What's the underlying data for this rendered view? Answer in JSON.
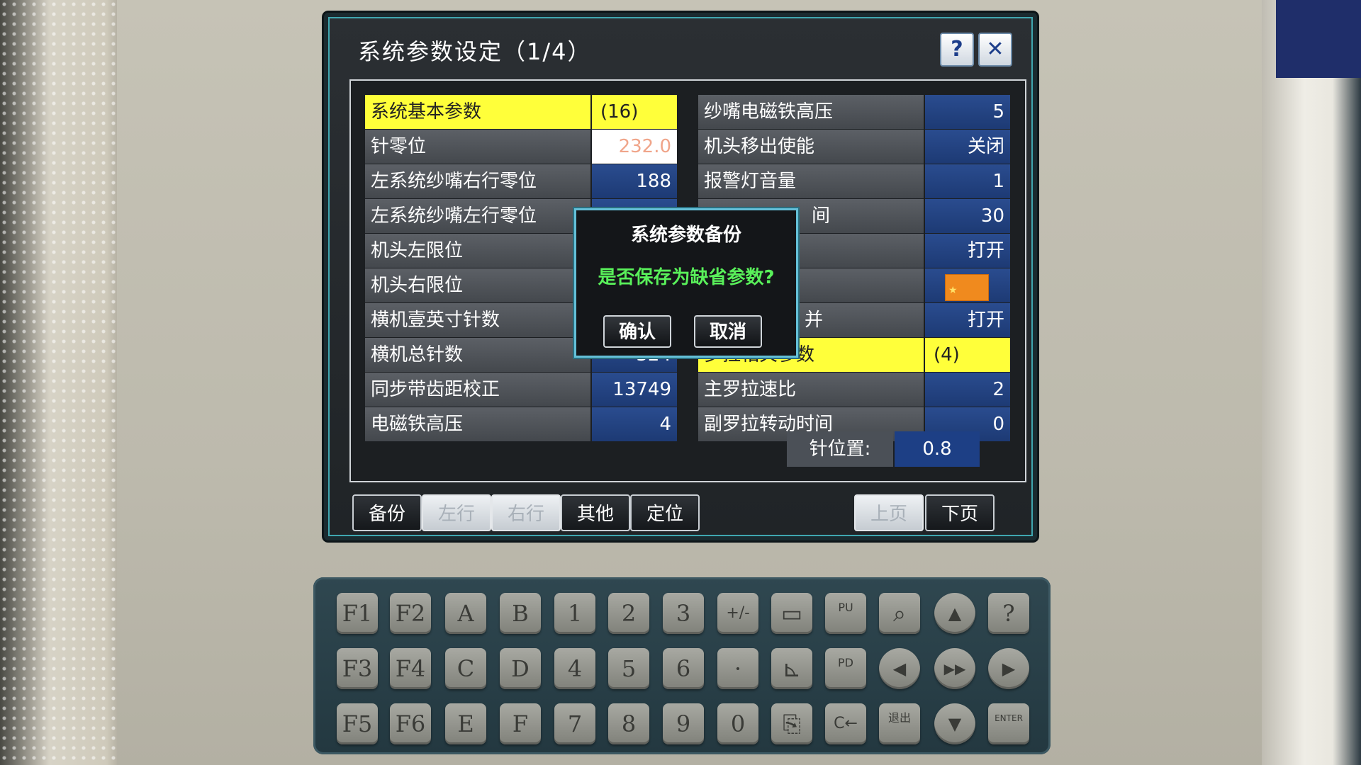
{
  "window": {
    "title": "系统参数设定（1/4）",
    "help_label": "?",
    "close_label": "✕"
  },
  "left_table": {
    "rows": [
      {
        "label": "系统基本参数",
        "value": "(16)"
      },
      {
        "label": "针零位",
        "value": "232.0"
      },
      {
        "label": "左系统纱嘴右行零位",
        "value": "188"
      },
      {
        "label": "左系统纱嘴左行零位",
        "value": ""
      },
      {
        "label": "机头左限位",
        "value": ""
      },
      {
        "label": "机头右限位",
        "value": ""
      },
      {
        "label": "横机壹英寸针数",
        "value": ""
      },
      {
        "label": "横机总针数",
        "value": "324"
      },
      {
        "label": "同步带齿距校正",
        "value": "13749"
      },
      {
        "label": "电磁铁高压",
        "value": "4"
      }
    ]
  },
  "right_table": {
    "rows": [
      {
        "label": "纱嘴电磁铁高压",
        "value": "5"
      },
      {
        "label": "机头移出使能",
        "value": "关闭"
      },
      {
        "label": "报警灯音量",
        "value": "1"
      },
      {
        "label": "间",
        "value": "30"
      },
      {
        "label": "",
        "value": "打开"
      },
      {
        "label": "",
        "value": ""
      },
      {
        "label": "并",
        "value": "打开"
      },
      {
        "label": "罗拉相关参数",
        "value": "(4)"
      },
      {
        "label": "主罗拉速比",
        "value": "2"
      },
      {
        "label": "副罗拉转动时间",
        "value": "0"
      }
    ]
  },
  "needle_position": {
    "label": "针位置:",
    "value": "0.8"
  },
  "buttons": {
    "backup": "备份",
    "left": "左行",
    "right": "右行",
    "other": "其他",
    "locate": "定位",
    "prev": "上页",
    "next": "下页"
  },
  "dialog": {
    "title": "系统参数备份",
    "message": "是否保存为缺省参数?",
    "confirm": "确认",
    "cancel": "取消"
  },
  "keypad": {
    "row1": [
      "F1",
      "F2",
      "A",
      "B",
      "1",
      "2",
      "3",
      "+/-",
      "▭",
      "PU",
      "⌕",
      "▲",
      "?"
    ],
    "row2": [
      "F3",
      "F4",
      "C",
      "D",
      "4",
      "5",
      "6",
      "·",
      "⊾",
      "PD",
      "◀",
      "▶▶",
      "▶"
    ],
    "row3": [
      "F5",
      "F6",
      "E",
      "F",
      "7",
      "8",
      "9",
      "0",
      "⎘",
      "C←",
      "退出",
      "▼",
      "ENTER"
    ]
  },
  "colors": {
    "header_yellow": "#ffff3a",
    "value_blue": "#1d3a74",
    "dialog_message_green": "#59f05a",
    "frame_cyan": "#3fa7b0"
  }
}
